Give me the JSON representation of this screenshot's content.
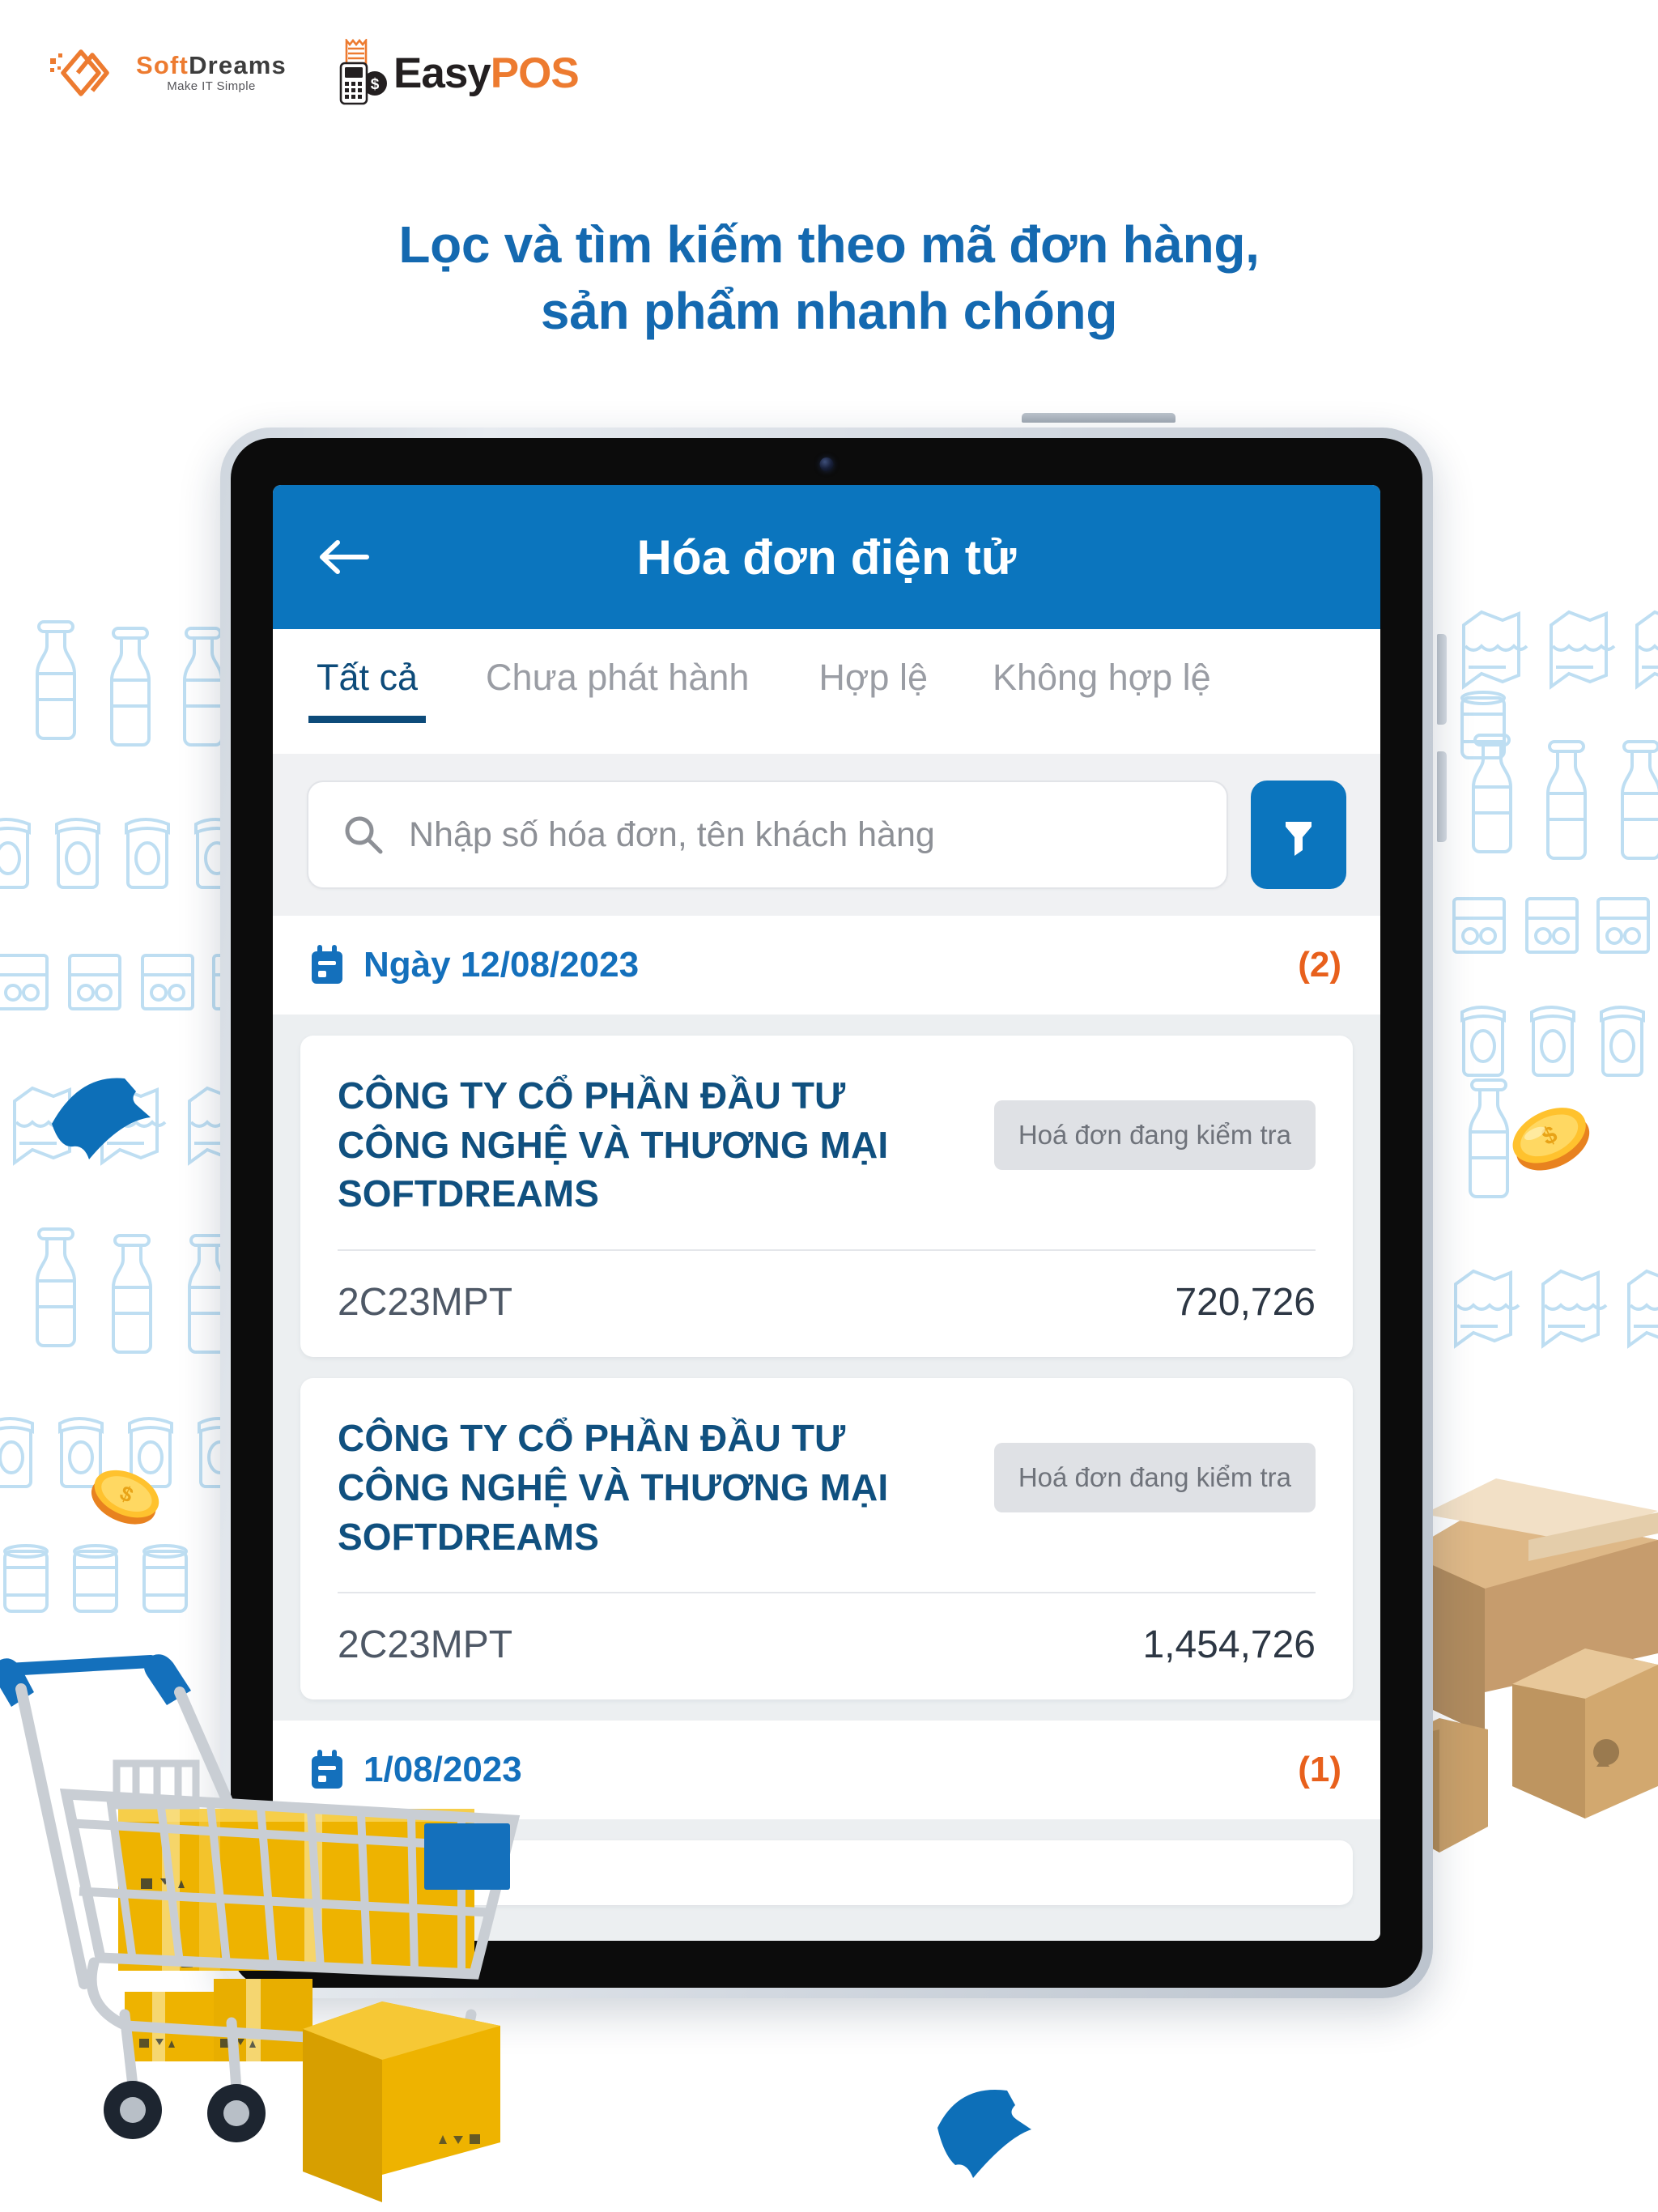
{
  "branding": {
    "softdreams": {
      "name_soft": "Soft",
      "name_dreams": "Dreams",
      "tagline": "Make IT Simple"
    },
    "easypos": {
      "easy": "Easy",
      "pos": "POS"
    },
    "colors": {
      "orange": "#ED7B30",
      "brand_blue": "#0B75BE",
      "headline_blue": "#1469B0",
      "navy": "#0d4b7a",
      "count_orange": "#E8601C"
    }
  },
  "headline": {
    "line1": "Lọc và tìm kiếm theo mã đơn hàng,",
    "line2": "sản phẩm nhanh chóng"
  },
  "app": {
    "header": {
      "title": "Hóa đơn điện tử",
      "back_icon": "arrow-left-icon"
    },
    "tabs": [
      {
        "label": "Tất cả",
        "active": true
      },
      {
        "label": "Chưa phát hành",
        "active": false
      },
      {
        "label": "Hợp lệ",
        "active": false
      },
      {
        "label": "Không hợp lệ",
        "active": false
      }
    ],
    "search": {
      "placeholder": "Nhập số hóa đơn, tên khách hàng",
      "value": "",
      "search_icon": "search-icon",
      "filter_icon": "filter-funnel-icon"
    },
    "groups": [
      {
        "date_label": "Ngày 12/08/2023",
        "count": "(2)",
        "calendar_icon": "calendar-icon",
        "invoices": [
          {
            "customer": "CÔNG TY CỔ PHẦN ĐẦU TƯ CÔNG NGHỆ VÀ THƯƠNG MẠI SOFTDREAMS",
            "status": "Hoá đơn đang kiểm tra",
            "code": "2C23MPT",
            "amount": "720,726"
          },
          {
            "customer": "CÔNG TY CỔ PHẦN ĐẦU TƯ CÔNG NGHỆ VÀ THƯƠNG MẠI SOFTDREAMS",
            "status": "Hoá đơn đang kiểm tra",
            "code": "2C23MPT",
            "amount": "1,454,726"
          }
        ]
      },
      {
        "date_label": "1/08/2023",
        "count": "(1)",
        "calendar_icon": "calendar-icon",
        "invoices": []
      }
    ]
  }
}
